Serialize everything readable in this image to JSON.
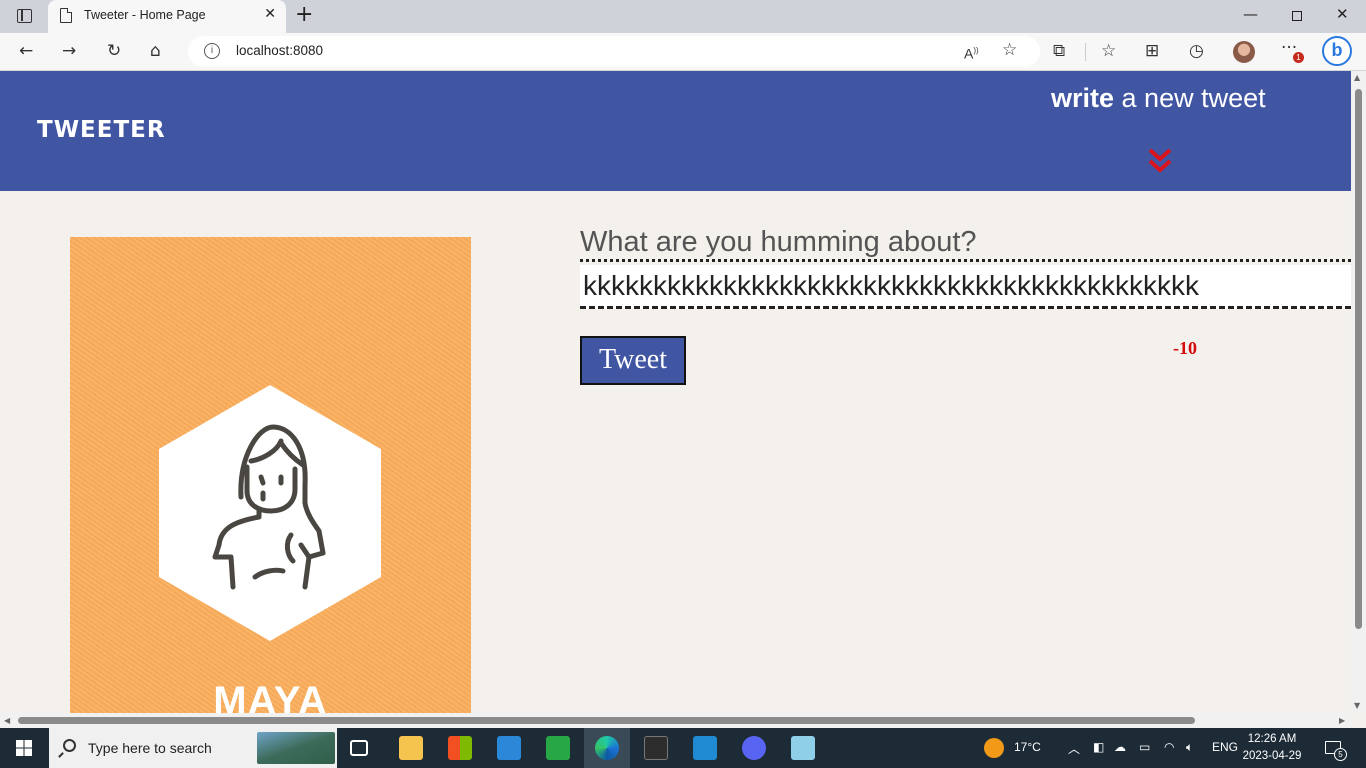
{
  "browser": {
    "tab_title": "Tweeter - Home Page",
    "tab_close": "✕",
    "new_tab": "+",
    "url": "localhost:8080",
    "notification_count": "1"
  },
  "page": {
    "brand": "TWEETER",
    "compose_bold": "write",
    "compose_rest": " a new tweet",
    "profile_name": "MAYA",
    "question": "What are you humming about?",
    "tweet_value": "kkkkkkkkkkkkkkkkkkkkkkkkkkkkkkkkkkkkkkkkkkkk",
    "tweet_button": "Tweet",
    "char_counter": "-10",
    "colors": {
      "header": "#4156a3",
      "profile_bg": "#fbae5c",
      "counter": "#d40b0b"
    }
  },
  "taskbar": {
    "search_placeholder": "Type here to search",
    "weather": "17°C",
    "language": "ENG",
    "time": "12:26 AM",
    "date": "2023-04-29",
    "notifications": "5"
  },
  "icons": [
    "tab-actions-icon",
    "page-icon",
    "back-icon",
    "forward-icon",
    "refresh-icon",
    "home-icon",
    "info-icon",
    "read-aloud-icon",
    "favorite-add-icon",
    "extensions-icon",
    "favorites-icon",
    "collections-icon",
    "history-icon",
    "profile-avatar",
    "more-icon",
    "bing-icon",
    "double-chevron-down-icon",
    "avatar-hexagon-icon",
    "windows-start-icon",
    "search-icon"
  ]
}
